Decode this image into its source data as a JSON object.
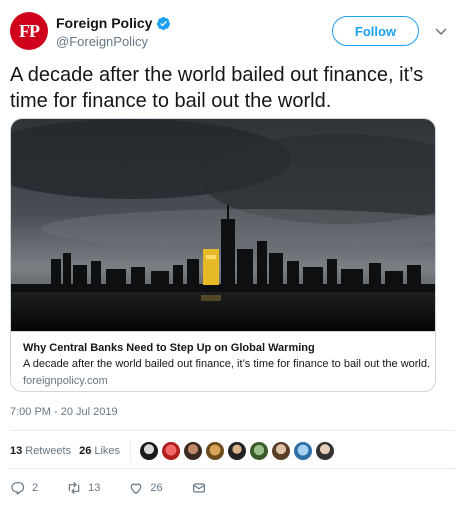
{
  "account": {
    "logo_text": "FP",
    "name": "Foreign Policy",
    "handle": "@ForeignPolicy",
    "follow_label": "Follow",
    "verified": true,
    "brand_color": "#d0021b"
  },
  "tweet": {
    "text": "A decade after the world bailed out finance, it’s time for finance to bail out the world.",
    "timestamp": "7:00 PM - 20 Jul 2019"
  },
  "card": {
    "title": "Why Central Banks Need to Step Up on Global Warming",
    "description": "A decade after the world bailed out finance, it’s time for finance to bail out the world.",
    "domain": "foreignpolicy.com"
  },
  "stats": {
    "retweets_count": "13",
    "retweets_label": "Retweets",
    "likes_count": "26",
    "likes_label": "Likes"
  },
  "actions": {
    "reply_count": "2",
    "retweet_count": "13",
    "like_count": "26"
  },
  "colors": {
    "accent": "#1da1f2",
    "text": "#14171a",
    "muted": "#657786",
    "border": "#ccd6dd"
  }
}
